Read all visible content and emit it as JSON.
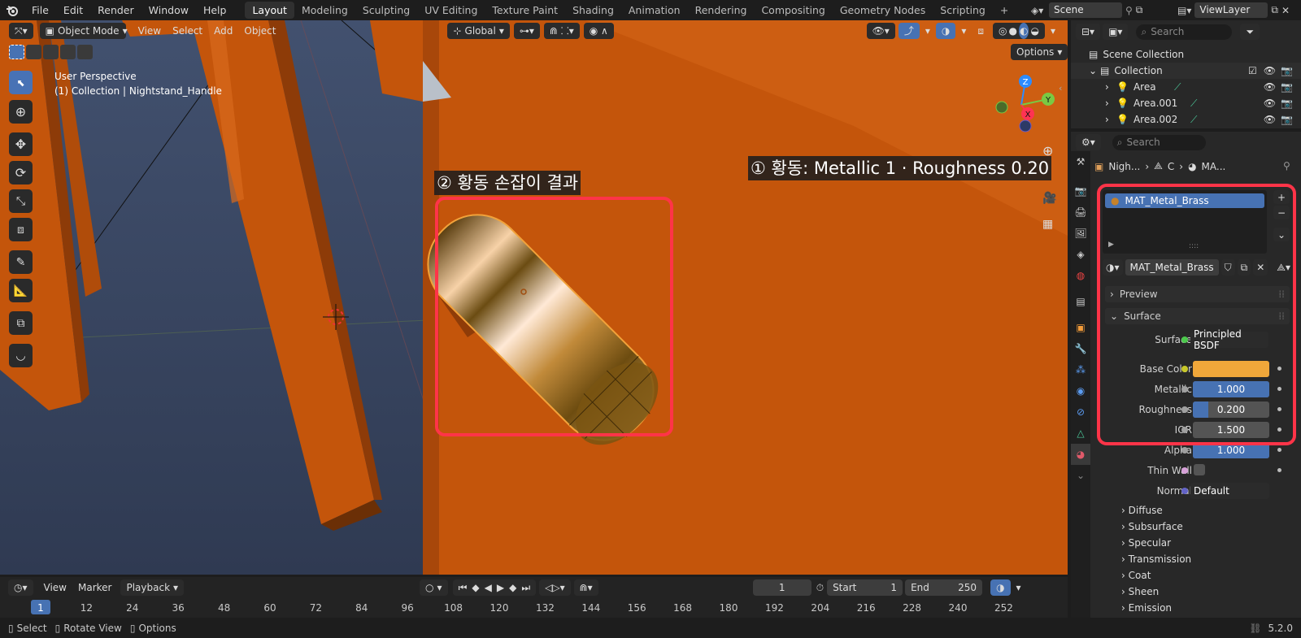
{
  "top_menu": [
    "File",
    "Edit",
    "Render",
    "Window",
    "Help"
  ],
  "workspaces": [
    "Layout",
    "Modeling",
    "Sculpting",
    "UV Editing",
    "Texture Paint",
    "Shading",
    "Animation",
    "Rendering",
    "Compositing",
    "Geometry Nodes",
    "Scripting"
  ],
  "add_workspace": "+",
  "scene_name": "Scene",
  "view_layer": "ViewLayer",
  "viewport": {
    "mode": "Object Mode",
    "menus": [
      "View",
      "Select",
      "Add",
      "Object"
    ],
    "transform_orientation": "Global",
    "options_label": "Options",
    "perspective_label": "User Perspective",
    "collection_label": "(1) Collection | Nightstand_Handle",
    "gizmo_axes": {
      "z": "Z",
      "y": "Y",
      "x": "X"
    },
    "annotation_result": "② 황동 손잡이 결과",
    "annotation_settings": "① 황동: Metallic 1 · Roughness 0.20"
  },
  "outliner": {
    "search_placeholder": "Search",
    "root": "Scene Collection",
    "collection": "Collection",
    "items": [
      "Area",
      "Area.001",
      "Area.002"
    ]
  },
  "properties": {
    "search_placeholder": "Search",
    "breadcrumb": [
      "Nigh...",
      "C",
      "MA..."
    ],
    "slot_material": "MAT_Metal_Brass",
    "material_name": "MAT_Metal_Brass",
    "sections": {
      "preview": "Preview",
      "surface": "Surface"
    },
    "surface_label": "Surface",
    "surface_shader": "Principled BSDF",
    "base_color_label": "Base Color",
    "base_color": "#f0a73a",
    "metallic_label": "Metallic",
    "metallic": "1.000",
    "metallic_fraction": 1.0,
    "roughness_label": "Roughness",
    "roughness": "0.200",
    "roughness_fraction": 0.2,
    "ior_label": "IOR",
    "ior": "1.500",
    "alpha_label": "Alpha",
    "alpha": "1.000",
    "alpha_fraction": 1.0,
    "thin_wall_label": "Thin Wall",
    "normal_label": "Normal",
    "normal": "Default",
    "subpanels": [
      "Diffuse",
      "Subsurface",
      "Specular",
      "Transmission",
      "Coat",
      "Sheen",
      "Emission"
    ]
  },
  "timeline": {
    "menus": [
      "View",
      "Marker",
      "Playback"
    ],
    "current_frame": "1",
    "start_label": "Start",
    "start": "1",
    "end_label": "End",
    "end": "250",
    "ticks": [
      "1",
      "12",
      "24",
      "36",
      "48",
      "60",
      "72",
      "84",
      "96",
      "108",
      "120",
      "132",
      "144",
      "156",
      "168",
      "180",
      "192",
      "204",
      "216",
      "228",
      "240",
      "252"
    ]
  },
  "statusbar": {
    "select": "Select",
    "rotate": "Rotate View",
    "options": "Options",
    "version": "5.2.0"
  },
  "colors": {
    "accent_blue": "#4772b3",
    "highlight_red": "#ff3448",
    "wood_orange": "#c4550a",
    "brass": "#d9a24a"
  }
}
